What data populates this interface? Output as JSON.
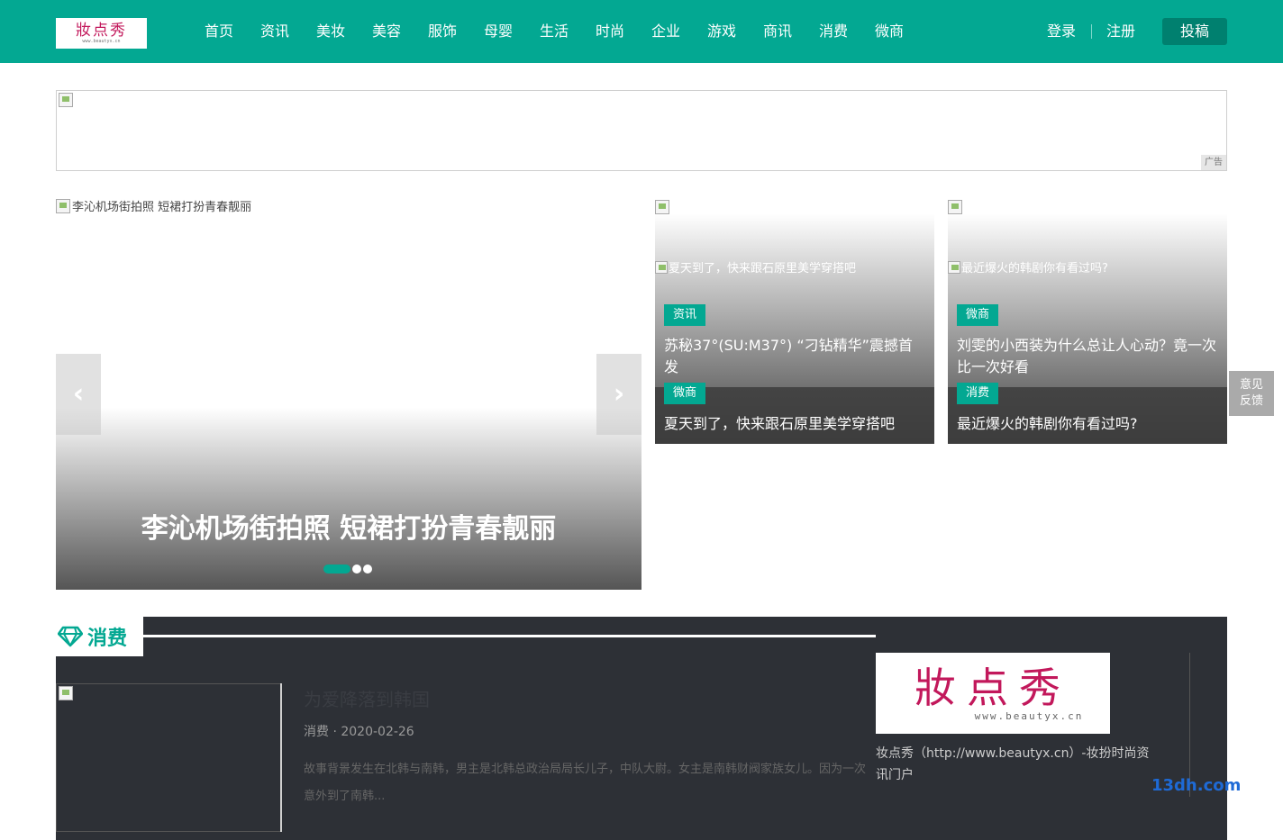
{
  "header": {
    "logo_text": "妝点秀",
    "logo_sub": "www.beautyx.cn",
    "nav": [
      "首页",
      "资讯",
      "美妆",
      "美容",
      "服饰",
      "母婴",
      "生活",
      "时尚",
      "企业",
      "游戏",
      "商讯",
      "消费",
      "微商"
    ],
    "login": "登录",
    "register": "注册",
    "submit": "投稿"
  },
  "ad": {
    "tag": "广告"
  },
  "slider": {
    "image_alt": "李沁机场街拍照 短裙打扮青春靓丽",
    "title": "李沁机场街拍照 短裙打扮青春靓丽",
    "prev_icon": "‹",
    "next_icon": "›",
    "slide_count": 3,
    "active_slide": 1
  },
  "cards": [
    {
      "image_alt": "夏天到了，快来跟石原里美学穿搭吧",
      "tag1": "资讯",
      "title1": "苏秘37°(SU:M37°) “刁钻精华”震撼首发",
      "tag2": "微商",
      "title2": "夏天到了，快来跟石原里美学穿搭吧"
    },
    {
      "image_alt": "最近爆火的韩剧你有看过吗?",
      "tag1": "微商",
      "title1": "刘雯的小西装为什么总让人心动？竟一次比一次好看",
      "tag2": "消费",
      "title2": "最近爆火的韩剧你有看过吗?"
    }
  ],
  "feedback": {
    "line1": "意见",
    "line2": "反馈"
  },
  "section": {
    "title": "消费",
    "icon": "diamond-icon",
    "article": {
      "title": "为爱降落到韩国",
      "meta": "消费 · 2020-02-26",
      "excerpt": "故事背景发生在北韩与南韩，男主是北韩总政治局局长儿子，中队大尉。女主是南韩财阀家族女儿。因为一次意外到了南韩..."
    },
    "sponsor": {
      "logo_text": "妝点秀",
      "logo_sub": "www.beautyx.cn",
      "desc": "妆点秀（http://www.beautyx.cn）-妆扮时尚资讯门户"
    }
  },
  "watermark": "13dh.com",
  "colors": {
    "brand": "#03a892",
    "dark": "#2d3036",
    "logo": "#c2185b"
  }
}
